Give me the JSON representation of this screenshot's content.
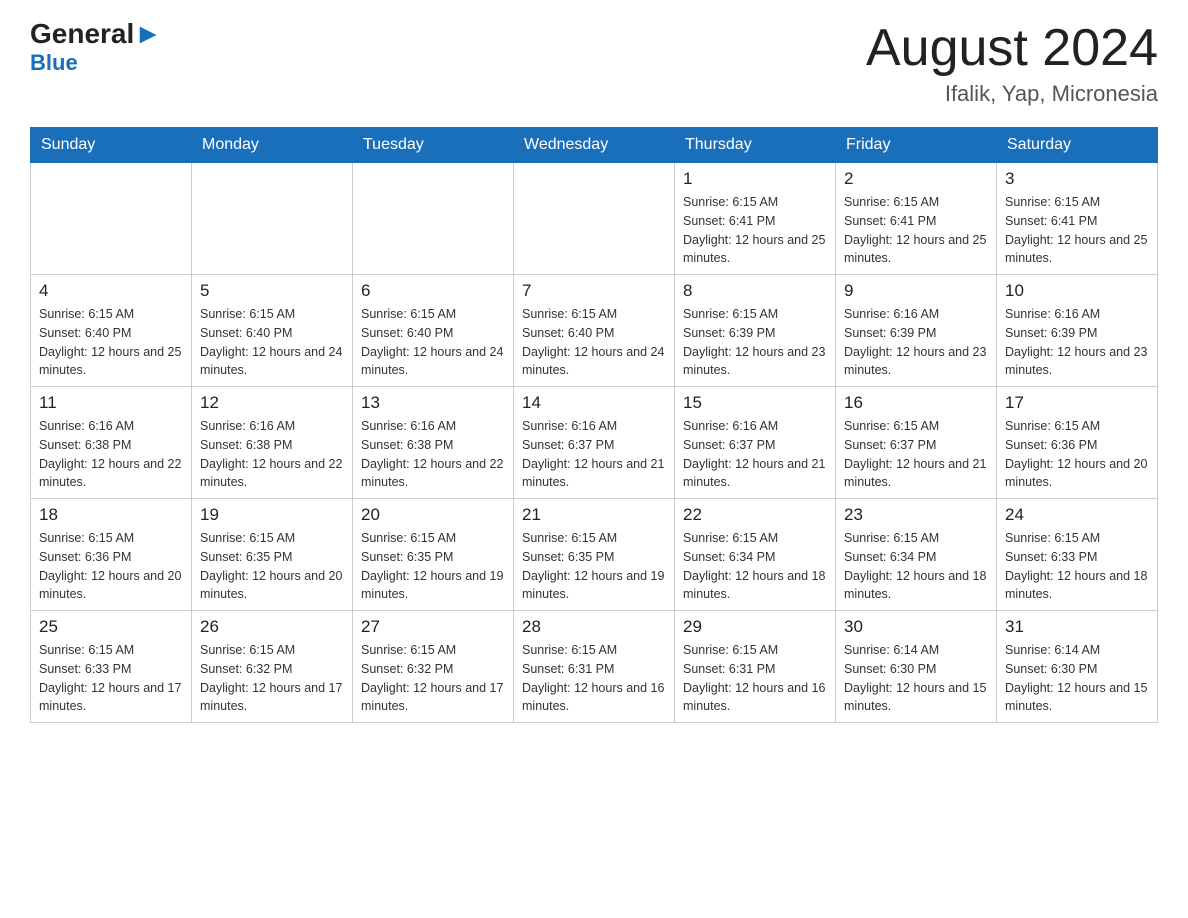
{
  "header": {
    "logo_main": "General",
    "logo_blue": "Blue",
    "month_title": "August 2024",
    "location": "Ifalik, Yap, Micronesia"
  },
  "weekdays": [
    "Sunday",
    "Monday",
    "Tuesday",
    "Wednesday",
    "Thursday",
    "Friday",
    "Saturday"
  ],
  "weeks": [
    [
      {
        "day": "",
        "sunrise": "",
        "sunset": "",
        "daylight": ""
      },
      {
        "day": "",
        "sunrise": "",
        "sunset": "",
        "daylight": ""
      },
      {
        "day": "",
        "sunrise": "",
        "sunset": "",
        "daylight": ""
      },
      {
        "day": "",
        "sunrise": "",
        "sunset": "",
        "daylight": ""
      },
      {
        "day": "1",
        "sunrise": "Sunrise: 6:15 AM",
        "sunset": "Sunset: 6:41 PM",
        "daylight": "Daylight: 12 hours and 25 minutes."
      },
      {
        "day": "2",
        "sunrise": "Sunrise: 6:15 AM",
        "sunset": "Sunset: 6:41 PM",
        "daylight": "Daylight: 12 hours and 25 minutes."
      },
      {
        "day": "3",
        "sunrise": "Sunrise: 6:15 AM",
        "sunset": "Sunset: 6:41 PM",
        "daylight": "Daylight: 12 hours and 25 minutes."
      }
    ],
    [
      {
        "day": "4",
        "sunrise": "Sunrise: 6:15 AM",
        "sunset": "Sunset: 6:40 PM",
        "daylight": "Daylight: 12 hours and 25 minutes."
      },
      {
        "day": "5",
        "sunrise": "Sunrise: 6:15 AM",
        "sunset": "Sunset: 6:40 PM",
        "daylight": "Daylight: 12 hours and 24 minutes."
      },
      {
        "day": "6",
        "sunrise": "Sunrise: 6:15 AM",
        "sunset": "Sunset: 6:40 PM",
        "daylight": "Daylight: 12 hours and 24 minutes."
      },
      {
        "day": "7",
        "sunrise": "Sunrise: 6:15 AM",
        "sunset": "Sunset: 6:40 PM",
        "daylight": "Daylight: 12 hours and 24 minutes."
      },
      {
        "day": "8",
        "sunrise": "Sunrise: 6:15 AM",
        "sunset": "Sunset: 6:39 PM",
        "daylight": "Daylight: 12 hours and 23 minutes."
      },
      {
        "day": "9",
        "sunrise": "Sunrise: 6:16 AM",
        "sunset": "Sunset: 6:39 PM",
        "daylight": "Daylight: 12 hours and 23 minutes."
      },
      {
        "day": "10",
        "sunrise": "Sunrise: 6:16 AM",
        "sunset": "Sunset: 6:39 PM",
        "daylight": "Daylight: 12 hours and 23 minutes."
      }
    ],
    [
      {
        "day": "11",
        "sunrise": "Sunrise: 6:16 AM",
        "sunset": "Sunset: 6:38 PM",
        "daylight": "Daylight: 12 hours and 22 minutes."
      },
      {
        "day": "12",
        "sunrise": "Sunrise: 6:16 AM",
        "sunset": "Sunset: 6:38 PM",
        "daylight": "Daylight: 12 hours and 22 minutes."
      },
      {
        "day": "13",
        "sunrise": "Sunrise: 6:16 AM",
        "sunset": "Sunset: 6:38 PM",
        "daylight": "Daylight: 12 hours and 22 minutes."
      },
      {
        "day": "14",
        "sunrise": "Sunrise: 6:16 AM",
        "sunset": "Sunset: 6:37 PM",
        "daylight": "Daylight: 12 hours and 21 minutes."
      },
      {
        "day": "15",
        "sunrise": "Sunrise: 6:16 AM",
        "sunset": "Sunset: 6:37 PM",
        "daylight": "Daylight: 12 hours and 21 minutes."
      },
      {
        "day": "16",
        "sunrise": "Sunrise: 6:15 AM",
        "sunset": "Sunset: 6:37 PM",
        "daylight": "Daylight: 12 hours and 21 minutes."
      },
      {
        "day": "17",
        "sunrise": "Sunrise: 6:15 AM",
        "sunset": "Sunset: 6:36 PM",
        "daylight": "Daylight: 12 hours and 20 minutes."
      }
    ],
    [
      {
        "day": "18",
        "sunrise": "Sunrise: 6:15 AM",
        "sunset": "Sunset: 6:36 PM",
        "daylight": "Daylight: 12 hours and 20 minutes."
      },
      {
        "day": "19",
        "sunrise": "Sunrise: 6:15 AM",
        "sunset": "Sunset: 6:35 PM",
        "daylight": "Daylight: 12 hours and 20 minutes."
      },
      {
        "day": "20",
        "sunrise": "Sunrise: 6:15 AM",
        "sunset": "Sunset: 6:35 PM",
        "daylight": "Daylight: 12 hours and 19 minutes."
      },
      {
        "day": "21",
        "sunrise": "Sunrise: 6:15 AM",
        "sunset": "Sunset: 6:35 PM",
        "daylight": "Daylight: 12 hours and 19 minutes."
      },
      {
        "day": "22",
        "sunrise": "Sunrise: 6:15 AM",
        "sunset": "Sunset: 6:34 PM",
        "daylight": "Daylight: 12 hours and 18 minutes."
      },
      {
        "day": "23",
        "sunrise": "Sunrise: 6:15 AM",
        "sunset": "Sunset: 6:34 PM",
        "daylight": "Daylight: 12 hours and 18 minutes."
      },
      {
        "day": "24",
        "sunrise": "Sunrise: 6:15 AM",
        "sunset": "Sunset: 6:33 PM",
        "daylight": "Daylight: 12 hours and 18 minutes."
      }
    ],
    [
      {
        "day": "25",
        "sunrise": "Sunrise: 6:15 AM",
        "sunset": "Sunset: 6:33 PM",
        "daylight": "Daylight: 12 hours and 17 minutes."
      },
      {
        "day": "26",
        "sunrise": "Sunrise: 6:15 AM",
        "sunset": "Sunset: 6:32 PM",
        "daylight": "Daylight: 12 hours and 17 minutes."
      },
      {
        "day": "27",
        "sunrise": "Sunrise: 6:15 AM",
        "sunset": "Sunset: 6:32 PM",
        "daylight": "Daylight: 12 hours and 17 minutes."
      },
      {
        "day": "28",
        "sunrise": "Sunrise: 6:15 AM",
        "sunset": "Sunset: 6:31 PM",
        "daylight": "Daylight: 12 hours and 16 minutes."
      },
      {
        "day": "29",
        "sunrise": "Sunrise: 6:15 AM",
        "sunset": "Sunset: 6:31 PM",
        "daylight": "Daylight: 12 hours and 16 minutes."
      },
      {
        "day": "30",
        "sunrise": "Sunrise: 6:14 AM",
        "sunset": "Sunset: 6:30 PM",
        "daylight": "Daylight: 12 hours and 15 minutes."
      },
      {
        "day": "31",
        "sunrise": "Sunrise: 6:14 AM",
        "sunset": "Sunset: 6:30 PM",
        "daylight": "Daylight: 12 hours and 15 minutes."
      }
    ]
  ]
}
